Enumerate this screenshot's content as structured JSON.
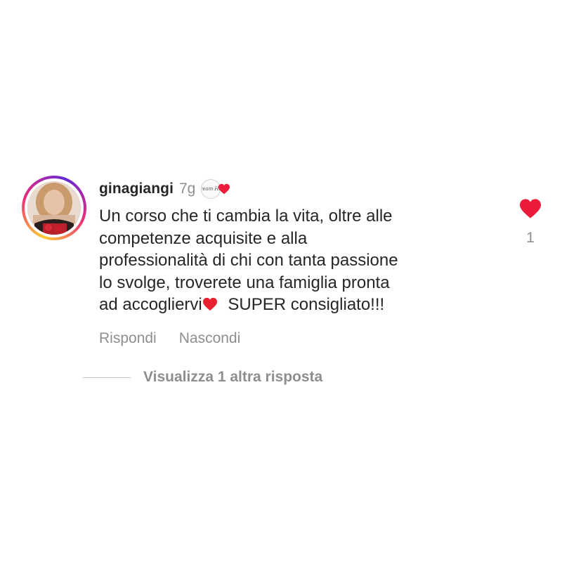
{
  "comment": {
    "username": "ginagiangi",
    "timestamp": "7g",
    "author_avatar_text": "Dream Hair",
    "text_lines": [
      "Un corso che ti cambia la vita, oltre alle",
      "competenze acquisite e alla",
      "professionalità di chi con tanta passione",
      "lo svolge, troverete una famiglia pronta",
      "ad accogliervi",
      " SUPER consigliato!!!"
    ],
    "like_count": "1",
    "actions": {
      "reply": "Rispondi",
      "hide": "Nascondi"
    },
    "view_replies": "Visualizza 1 altra risposta",
    "icons": {
      "avatar": "profile-photo",
      "liked_by_author": "heart-icon",
      "inline_emoji": "red-heart-emoji",
      "like": "heart-icon"
    },
    "colors": {
      "heart": "#ed1b3a",
      "text": "#262626",
      "secondary": "#8e8e8e"
    }
  }
}
